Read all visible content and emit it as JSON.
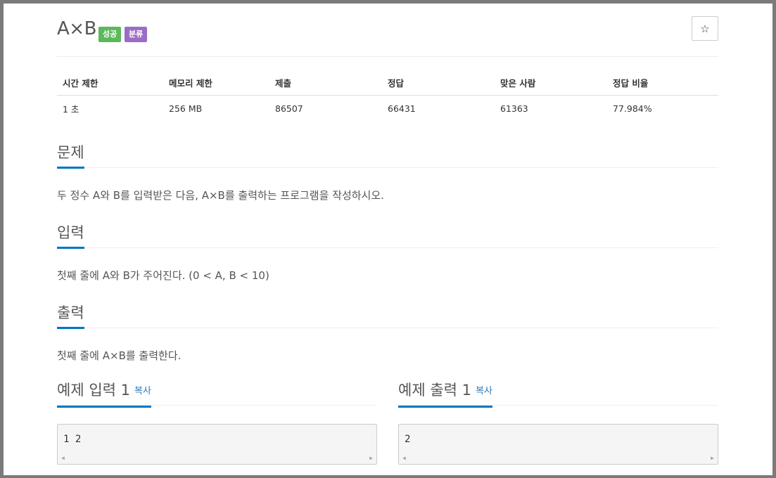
{
  "problem": {
    "title": "A×B",
    "badges": {
      "success": "성공",
      "category": "분류"
    },
    "star_icon": "☆"
  },
  "stats": {
    "headers": [
      "시간 제한",
      "메모리 제한",
      "제출",
      "정답",
      "맞은 사람",
      "정답 비율"
    ],
    "values": [
      "1 초",
      "256 MB",
      "86507",
      "66431",
      "61363",
      "77.984%"
    ]
  },
  "sections": {
    "description": {
      "title": "문제",
      "text": "두 정수 A와 B를 입력받은 다음, A×B를 출력하는 프로그램을 작성하시오."
    },
    "input": {
      "title": "입력",
      "text": "첫째 줄에 A와 B가 주어진다. (0 < A, B < 10)"
    },
    "output": {
      "title": "출력",
      "text": "첫째 줄에 A×B를 출력한다."
    }
  },
  "samples": {
    "input": {
      "title": "예제 입력 1",
      "copy": "복사",
      "content": "1 2"
    },
    "output": {
      "title": "예제 출력 1",
      "copy": "복사",
      "content": "2"
    }
  },
  "colors": {
    "accent": "#0076c0",
    "success": "#5cb85c",
    "category": "#9b6dc6",
    "link": "#2c7bb6"
  }
}
